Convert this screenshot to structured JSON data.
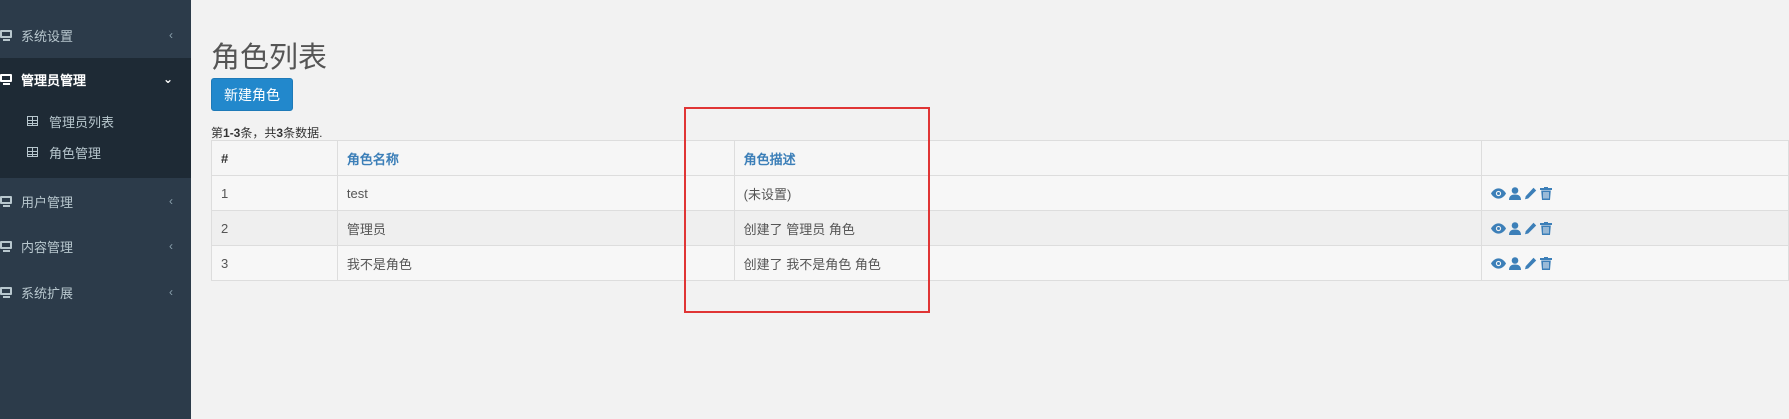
{
  "sidebar": {
    "items": [
      {
        "label": "系统设置",
        "icon": "monitor-icon",
        "chevron": "‹"
      },
      {
        "label": "管理员管理",
        "icon": "monitor-icon",
        "chevron": "⌄"
      },
      {
        "label": "用户管理",
        "icon": "monitor-icon",
        "chevron": "‹"
      },
      {
        "label": "内容管理",
        "icon": "monitor-icon",
        "chevron": "‹"
      },
      {
        "label": "系统扩展",
        "icon": "monitor-icon",
        "chevron": "‹"
      }
    ],
    "subitems": [
      {
        "label": "管理员列表",
        "icon": "table-icon"
      },
      {
        "label": "角色管理",
        "icon": "table-icon"
      }
    ]
  },
  "main": {
    "title": "角色列表",
    "new_button": "新建角色",
    "summary": {
      "prefix": "第",
      "range": "1-3",
      "mid": "条，共",
      "total": "3",
      "suffix": "条数据."
    },
    "table": {
      "headers": [
        "#",
        "角色名称",
        "角色描述",
        ""
      ],
      "rows": [
        {
          "num": "1",
          "name": "test",
          "desc": "(未设置)"
        },
        {
          "num": "2",
          "name": "管理员",
          "desc": "创建了 管理员 角色"
        },
        {
          "num": "3",
          "name": "我不是角色",
          "desc": "创建了 我不是角色 角色"
        }
      ],
      "row_actions": [
        "eye-icon",
        "user-icon",
        "pencil-icon",
        "trash-icon"
      ]
    }
  },
  "colors": {
    "sidebar_bg": "#2c3b4a",
    "accent": "#2288cc",
    "link": "#3c7fb8",
    "highlight": "#e03535"
  }
}
